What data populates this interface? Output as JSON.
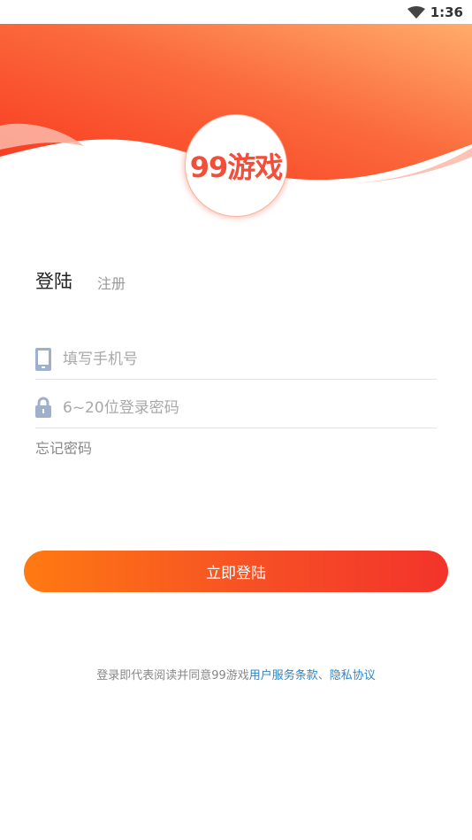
{
  "status_bar": {
    "time": "1:36",
    "wifi_icon": "wifi-icon"
  },
  "logo": {
    "text": "99游戏"
  },
  "tabs": {
    "login": "登陆",
    "register": "注册"
  },
  "form": {
    "phone": {
      "placeholder": "填写手机号",
      "value": "",
      "icon": "phone-icon"
    },
    "password": {
      "placeholder": "6~20位登录密码",
      "value": "",
      "icon": "lock-icon"
    },
    "forgot": "忘记密码"
  },
  "login_button": "立即登陆",
  "agreement": {
    "prefix": "登录即代表阅读并同意99游戏",
    "terms_link": "用户服务条款",
    "separator": "、",
    "privacy_link": "隐私协议"
  },
  "colors": {
    "brand": "#f24e3a",
    "gradient_start": "#ff7a12",
    "gradient_end": "#f3332b",
    "link": "#2f86c9"
  }
}
